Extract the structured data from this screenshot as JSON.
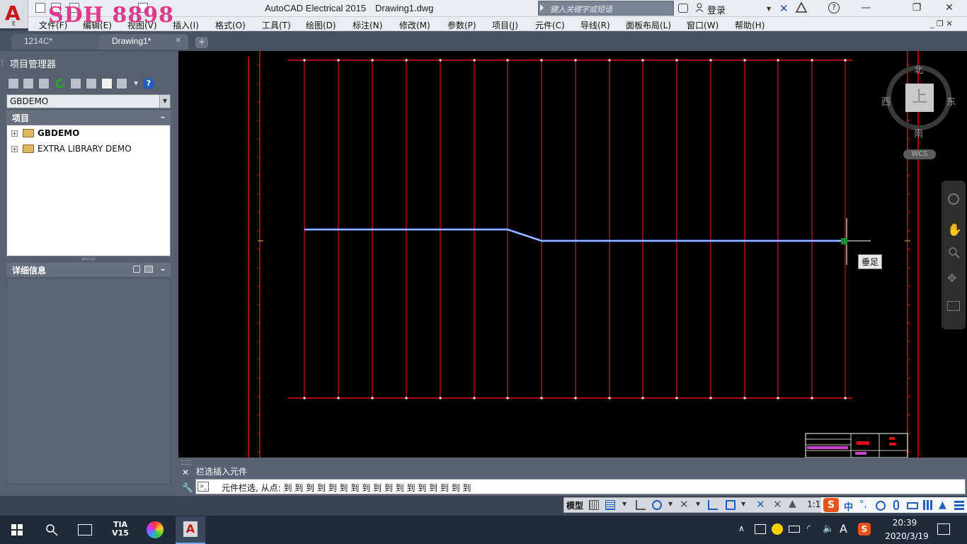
{
  "titlebar": {
    "app_title": "AutoCAD Electrical 2015",
    "doc_title": "Drawing1.dwg",
    "watermark": "SDH 8898",
    "search_placeholder": "键入关键字或短语",
    "login_label": "登录",
    "minimize": "—",
    "restore": "❐",
    "close": "✕"
  },
  "menu": {
    "items": [
      "文件(F)",
      "编辑(E)",
      "视图(V)",
      "插入(I)",
      "格式(O)",
      "工具(T)",
      "绘图(D)",
      "标注(N)",
      "修改(M)",
      "参数(P)",
      "项目(J)",
      "元件(C)",
      "导线(R)",
      "面板布局(L)",
      "窗口(W)",
      "帮助(H)"
    ]
  },
  "tabs": {
    "tab1": "1214C*",
    "tab2": "Drawing1*",
    "close_glyph": "✕",
    "new_glyph": "+"
  },
  "project_manager": {
    "title": "项目管理器",
    "selected_project": "GBDEMO",
    "projects_header": "项目",
    "collapse_glyph": "–",
    "tree": [
      "GBDEMO",
      "EXTRA LIBRARY DEMO"
    ],
    "detail_header": "详细信息"
  },
  "viewcube": {
    "north": "北",
    "south": "南",
    "east": "东",
    "west": "西",
    "top": "上",
    "wcs": "WCS"
  },
  "canvas": {
    "snap_tooltip": "垂足"
  },
  "command": {
    "history": "栏选插入元件",
    "current": "元件栏选, 从点: 到 到 到 到 到 到 到 到 到 到 到 到 到 到 到 到 到"
  },
  "status": {
    "model": "模型",
    "scale": "1:1"
  },
  "taskbar": {
    "tia_label": "TIA V15",
    "ime_chinese": "中",
    "time": "20:39",
    "date": "2020/3/19"
  },
  "colors": {
    "border_red": "#e01010",
    "wire_blue": "#4f7cff",
    "canvas_bg": "#000000",
    "accent_red": "#c7161b"
  }
}
